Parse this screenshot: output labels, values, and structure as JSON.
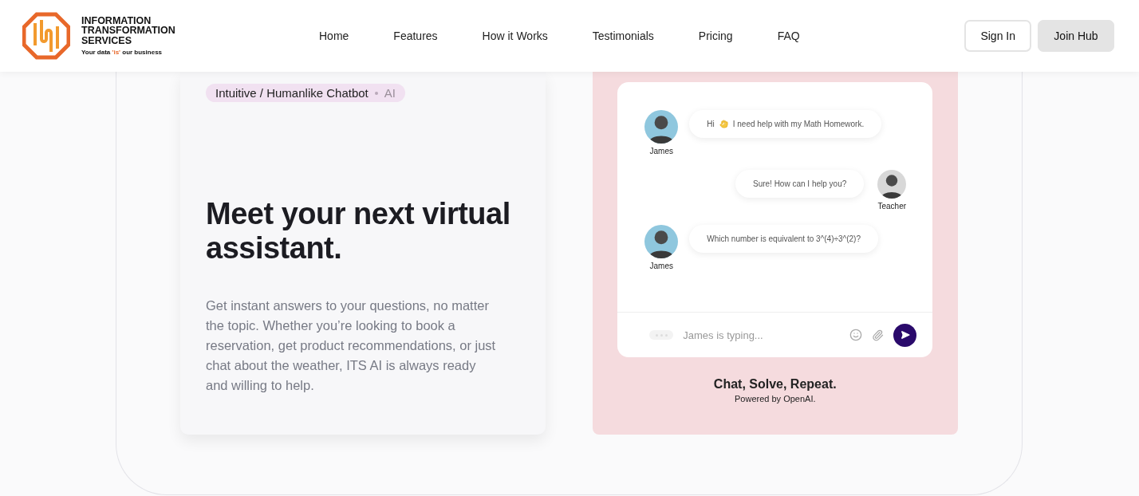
{
  "brand": {
    "line_1": "INFORMATION",
    "line_2": "TRANSFORMATION",
    "line_3": "SERVICES",
    "tagline_before": "Your data ",
    "tagline_highlight": "'is'",
    "tagline_after": " our business"
  },
  "nav": [
    {
      "label": "Home"
    },
    {
      "label": "Features"
    },
    {
      "label": "How it Works"
    },
    {
      "label": "Testimonials"
    },
    {
      "label": "Pricing"
    },
    {
      "label": "FAQ"
    }
  ],
  "actions": [
    {
      "label": "Sign In",
      "kind": "outline"
    },
    {
      "label": "Join Hub",
      "kind": "filled"
    }
  ],
  "feature": {
    "tag": "Intuitive / Humanlike Chatbot",
    "tag_suffix": "AI",
    "heading": "Meet your next virtual assistant.",
    "body": "Get instant answers to your questions, no matter the topic. Whether you’re looking to book a reservation, get product recommendations, or just chat about the weather, ITS AI is always ready and willing to help."
  },
  "chat": {
    "messages": [
      {
        "sender": "James",
        "kind": "student",
        "greeting": "Hi",
        "wave": true,
        "text": "I need help with my Math Homework."
      },
      {
        "sender": "Teacher",
        "kind": "teacher",
        "text": "Sure! How can I help you?"
      },
      {
        "sender": "James",
        "kind": "student",
        "text": "Which number is equivalent to 3^(4)÷3^(2)?"
      }
    ],
    "input_placeholder": "James is typing...",
    "caption": "Chat, Solve, Repeat.",
    "subcaption": "Powered by OpenAI."
  }
}
